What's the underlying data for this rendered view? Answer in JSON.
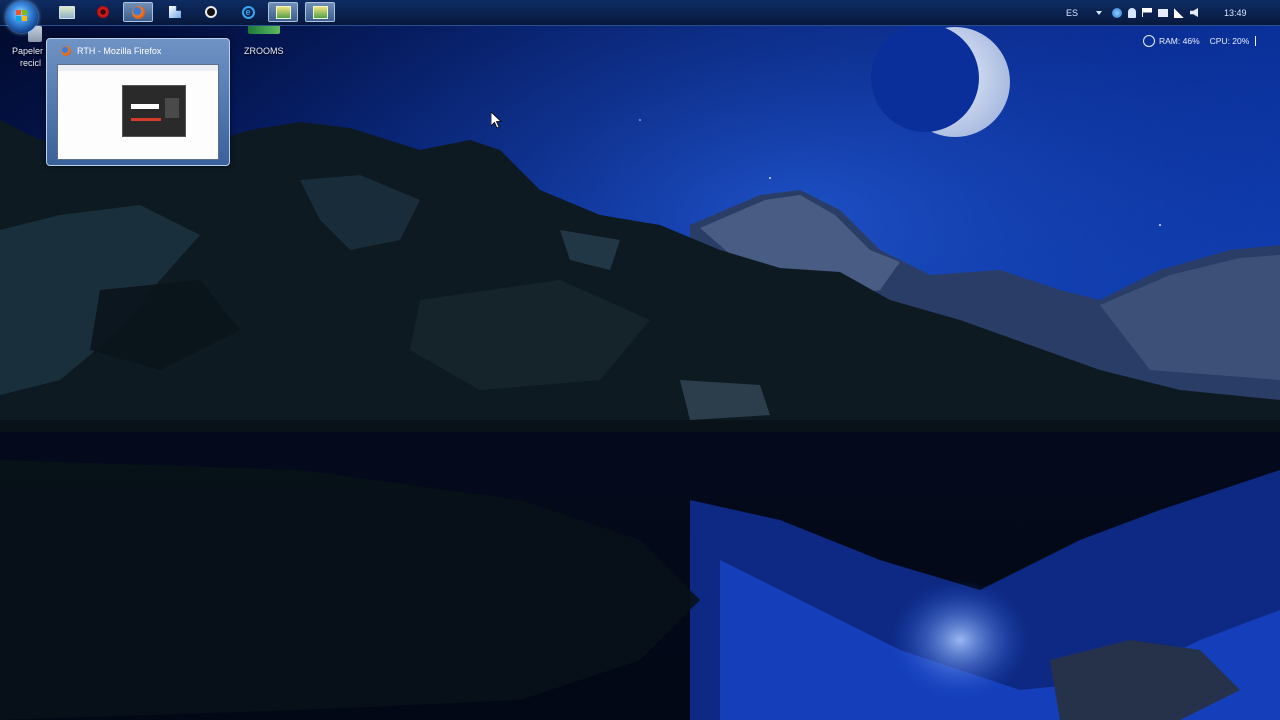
{
  "desktop": {
    "icons": [
      {
        "label": "Papeler",
        "sublabel": "recicl"
      },
      {
        "label": "ZROOMS"
      }
    ]
  },
  "taskbar": {
    "buttons": [
      {
        "icon": "windows-explorer-icon"
      },
      {
        "icon": "opera-icon"
      },
      {
        "icon": "firefox-icon",
        "active": true
      },
      {
        "icon": "media-icon"
      },
      {
        "icon": "steam-icon"
      },
      {
        "icon": "internet-explorer-icon"
      },
      {
        "icon": "image-viewer-icon",
        "active": true
      },
      {
        "icon": "image-viewer-icon",
        "active": true
      }
    ],
    "tray": {
      "language": "ES",
      "clock": "13:49"
    }
  },
  "preview": {
    "title": "RTH - Mozilla Firefox"
  },
  "gadget": {
    "ram": "RAM: 46%",
    "cpu": "CPU: 20%"
  },
  "colors": {
    "sky": "#0a2a8a",
    "accent": "#3b8be0"
  }
}
